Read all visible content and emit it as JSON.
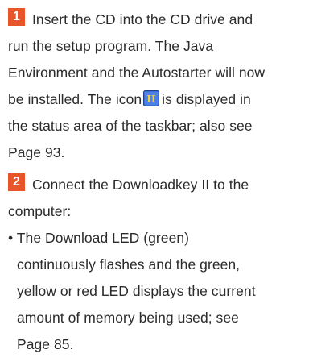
{
  "colors": {
    "step_badge": "#e8552b",
    "text": "#2b2b2b",
    "icon_blue": "#3a6fd8"
  },
  "step1": {
    "number": "1",
    "line1": "Insert the CD into the CD drive and",
    "line2": "run the setup program. The Java",
    "line3": "Environment and the Autostarter will now",
    "line4_before_icon": "be installed. The icon",
    "line4_after_icon": "is displayed in",
    "line5": "the status area of the taskbar; also see",
    "line6": "Page 93.",
    "icon_name": "autostarter-tray-icon",
    "icon_glyph": "II"
  },
  "step2": {
    "number": "2",
    "line1": "Connect the Downloadkey II to the",
    "line2": "computer:",
    "bullet_symbol": "•",
    "bullet_line1": "The Download LED (green)",
    "bullet_line2": "continuously flashes and the green,",
    "bullet_line3": "yellow or red LED displays the current",
    "bullet_line4": "amount of memory being used; see",
    "bullet_line5": "Page 85."
  }
}
